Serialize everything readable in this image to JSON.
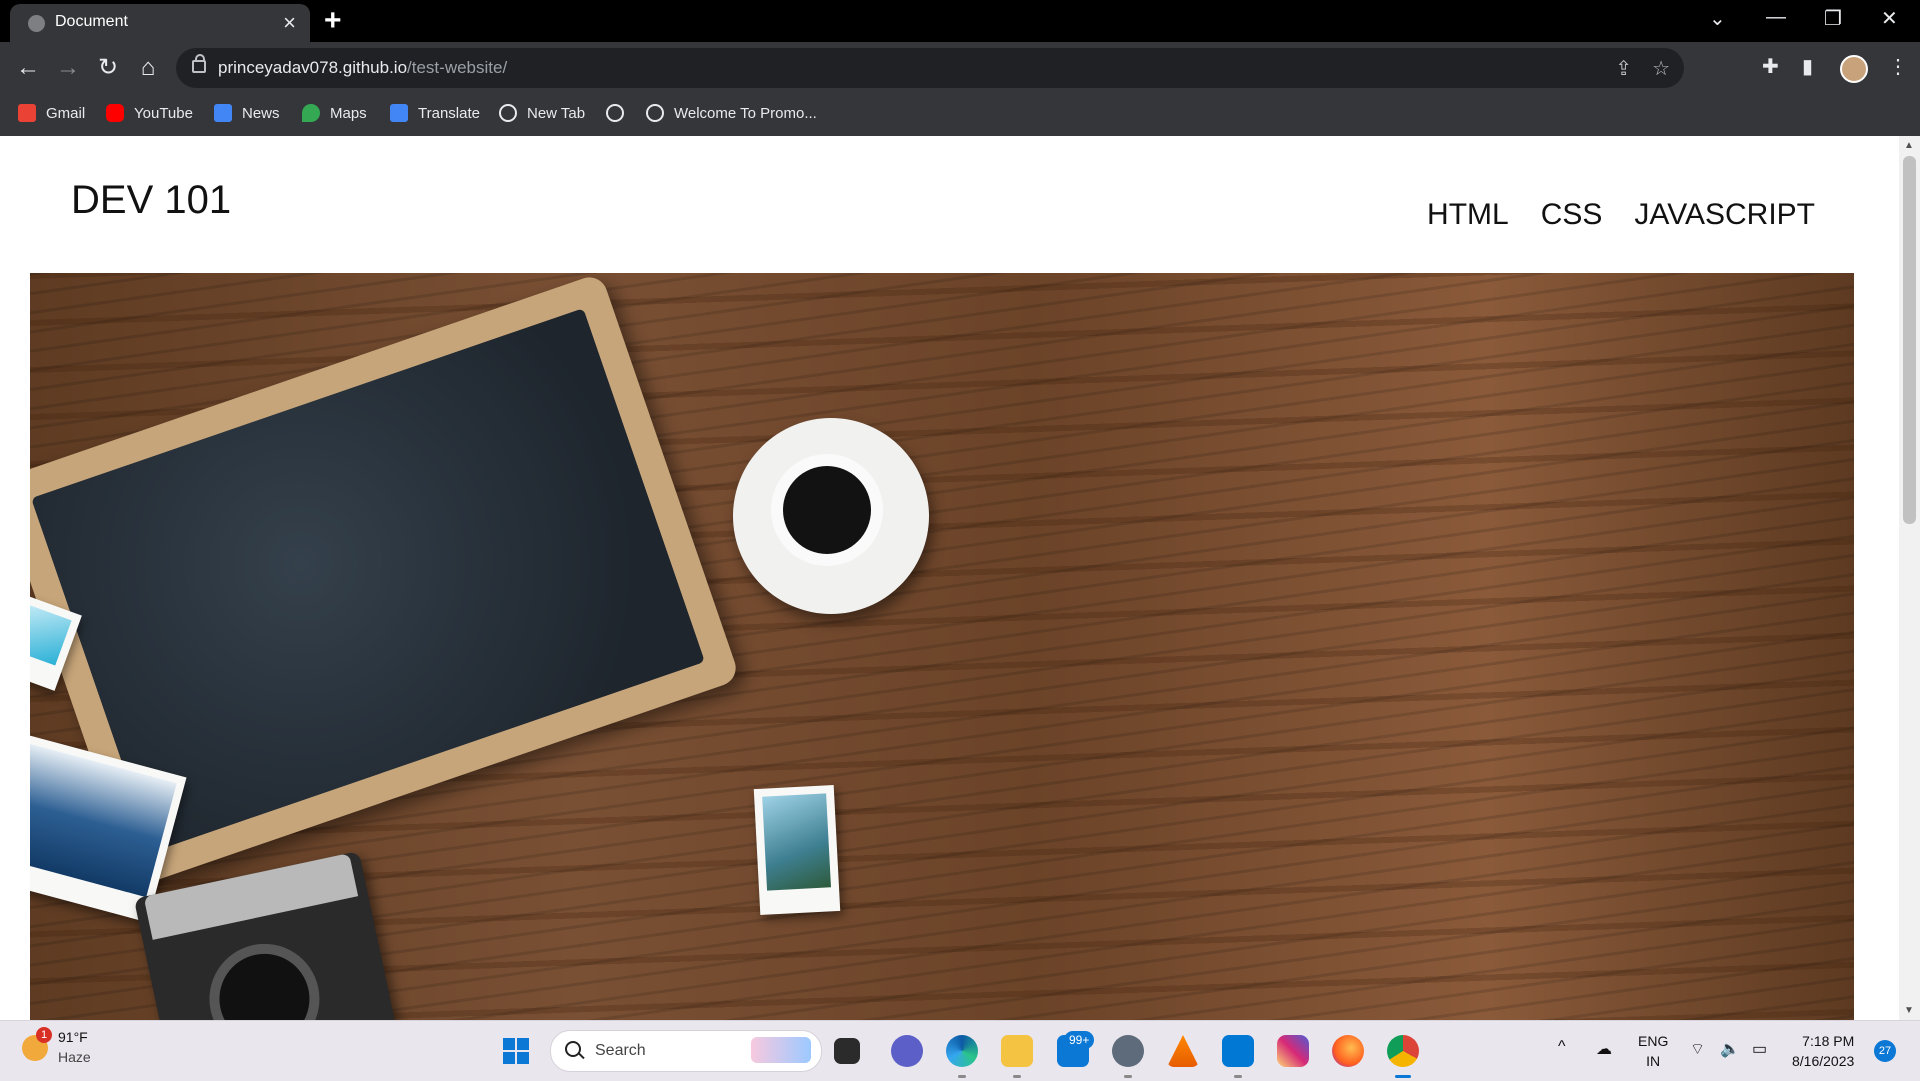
{
  "browser": {
    "tab_title": "Document",
    "new_tab_symbol": "+",
    "url_host": "princeyadav078.github.io",
    "url_path": "/test-website/",
    "bookmarks": [
      {
        "label": "Gmail",
        "icon": "gmail-icon",
        "color": "#ea4335"
      },
      {
        "label": "YouTube",
        "icon": "youtube-icon",
        "color": "#ff0000"
      },
      {
        "label": "News",
        "icon": "google-news-icon",
        "color": "#4285f4"
      },
      {
        "label": "Maps",
        "icon": "google-maps-icon",
        "color": "#34a853"
      },
      {
        "label": "Translate",
        "icon": "google-translate-icon",
        "color": "#4285f4"
      },
      {
        "label": "New Tab",
        "icon": "globe-icon",
        "color": "#e8eaed"
      },
      {
        "label": "",
        "icon": "globe-icon",
        "color": "#e8eaed"
      },
      {
        "label": "Welcome To Promo...",
        "icon": "globe-icon",
        "color": "#e8eaed"
      }
    ]
  },
  "site": {
    "logo": "DEV 101",
    "nav": [
      "HTML",
      "CSS",
      "JAVASCRIPT"
    ]
  },
  "taskbar": {
    "weather_temp": "91°F",
    "weather_desc": "Haze",
    "weather_badge": "1",
    "search_label": "Search",
    "mail_badge": "99+",
    "lang_top": "ENG",
    "lang_bottom": "IN",
    "time": "7:18 PM",
    "date": "8/16/2023",
    "notification_count": "27"
  },
  "theme": {
    "titlebar_bg": "#000000",
    "toolbar_bg": "#35363a",
    "accent": "#0a78d4"
  }
}
